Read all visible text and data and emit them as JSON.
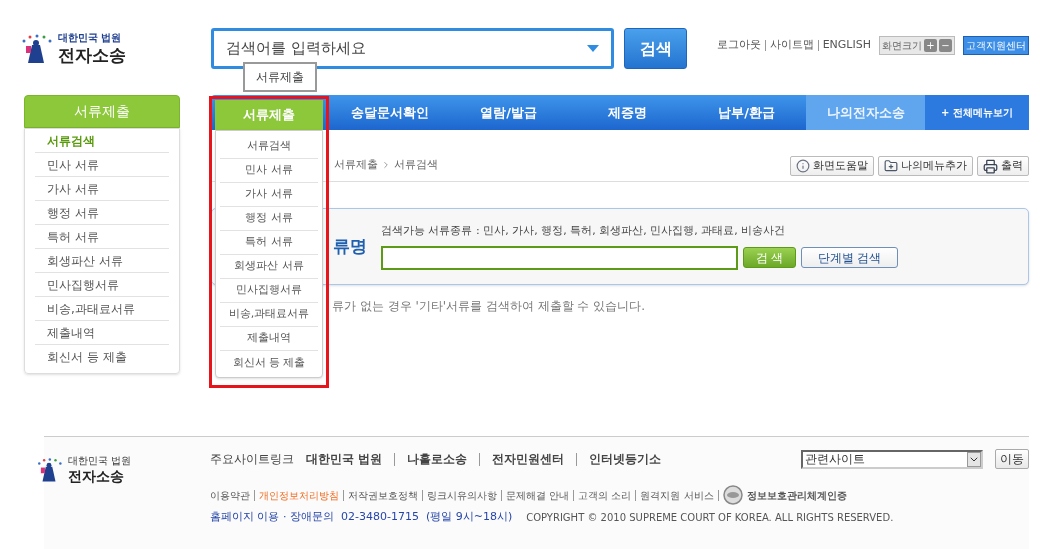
{
  "header": {
    "logo": {
      "line1": "대한민국 법원",
      "line2": "전자소송"
    },
    "search": {
      "placeholder": "검색어를 입력하세요"
    },
    "search_button": "검색",
    "top_links": [
      "로그아웃",
      "사이트맵",
      "ENGLISH"
    ],
    "font_size": {
      "label": "화면크기",
      "plus": "+",
      "minus": "−"
    },
    "support_button": "고객지원센터"
  },
  "tooltip": "서류제출",
  "nav": {
    "items": [
      {
        "label": "서류제출",
        "selected": true,
        "hovered": false
      },
      {
        "label": "송달문서확인",
        "selected": false,
        "hovered": false
      },
      {
        "label": "열람/발급",
        "selected": false,
        "hovered": false
      },
      {
        "label": "제증명",
        "selected": false,
        "hovered": false
      },
      {
        "label": "납부/환급",
        "selected": false,
        "hovered": false
      },
      {
        "label": "나의전자소송",
        "selected": false,
        "hovered": true
      }
    ],
    "all_menu": "+ 전체메뉴보기"
  },
  "sidebar": {
    "title": "서류제출",
    "items": [
      {
        "label": "서류검색",
        "selected": true
      },
      {
        "label": "민사 서류",
        "selected": false
      },
      {
        "label": "가사 서류",
        "selected": false
      },
      {
        "label": "행정 서류",
        "selected": false
      },
      {
        "label": "특허 서류",
        "selected": false
      },
      {
        "label": "회생파산 서류",
        "selected": false
      },
      {
        "label": "민사집행서류",
        "selected": false
      },
      {
        "label": "비송,과태료서류",
        "selected": false
      },
      {
        "label": "제출내역",
        "selected": false
      },
      {
        "label": "회신서 등 제출",
        "selected": false
      }
    ]
  },
  "dropdown": {
    "items": [
      "서류검색",
      "민사 서류",
      "가사 서류",
      "행정 서류",
      "특허 서류",
      "회생파산 서류",
      "민사집행서류",
      "비송,과태료서류",
      "제출내역",
      "회신서 등 제출"
    ]
  },
  "content": {
    "breadcrumb": [
      "서류제출",
      "서류검색"
    ],
    "tools": [
      {
        "label": "화면도움말",
        "kind": "help"
      },
      {
        "label": "나의메뉴추가",
        "kind": "add"
      },
      {
        "label": "출력",
        "kind": "print"
      }
    ],
    "search_panel": {
      "title": "류명",
      "hint": "검색가능 서류종류 : 민사, 가사, 행정, 특허, 회생파산, 민사집행, 과태료, 비송사건",
      "search_button": "검 색",
      "step_button": "단계별 검색"
    },
    "notice": "류가 없는 경우 '기타'서류를 검색하여 제출할 수 있습니다."
  },
  "footer": {
    "logo": {
      "line1": "대한민국 법원",
      "line2": "전자소송"
    },
    "sites_label": "주요사이트링크",
    "sites": [
      "대한민국 법원",
      "나홀로소송",
      "전자민원센터",
      "인터넷등기소"
    ],
    "related": {
      "value": "관련사이트"
    },
    "go_button": "이동",
    "policy_links": [
      {
        "label": "이용약관",
        "highlighted": false
      },
      {
        "label": "개인정보처리방침",
        "highlighted": true
      },
      {
        "label": "저작권보호정책",
        "highlighted": false
      },
      {
        "label": "링크시유의사항",
        "highlighted": false
      },
      {
        "label": "문제해결 안내",
        "highlighted": false
      },
      {
        "label": "고객의 소리",
        "highlighted": false
      },
      {
        "label": "원격지원 서비스",
        "highlighted": false
      }
    ],
    "cert": "정보보호관리체계인증",
    "contact": "홈페이지 이용 · 장애문의  02-3480-1715  (평일 9시~18시)",
    "copyright": "COPYRIGHT © 2010 SUPREME COURT OF KOREA. ALL RIGHTS RESERVED."
  }
}
